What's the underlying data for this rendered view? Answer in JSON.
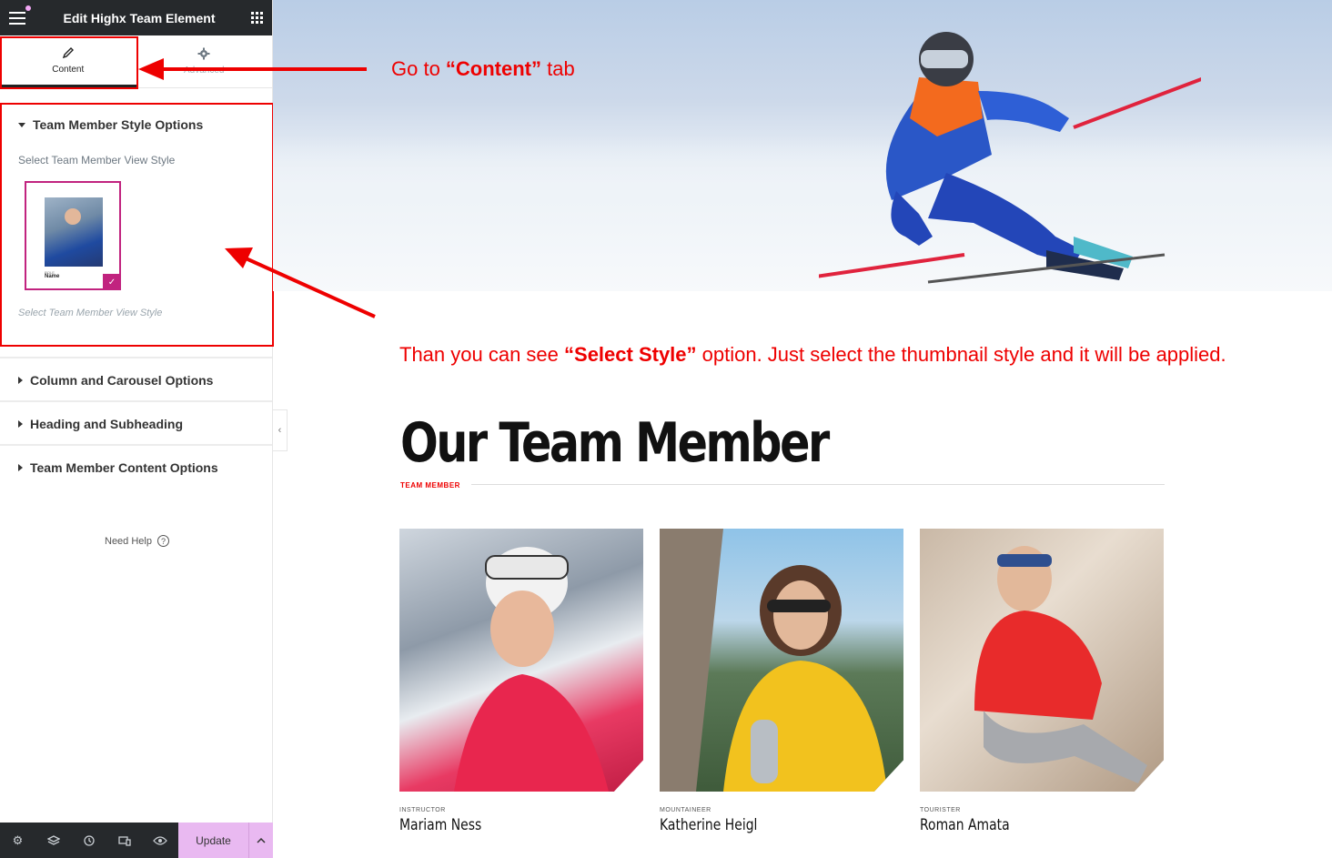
{
  "panel": {
    "title": "Edit Highx Team Element",
    "tabs": [
      {
        "label": "Content",
        "icon": "pencil-icon"
      },
      {
        "label": "Advanced",
        "icon": "gear-icon"
      }
    ],
    "sections": [
      {
        "label": "Team Member Style Options",
        "expanded": true
      },
      {
        "label": "Column and Carousel Options",
        "expanded": false
      },
      {
        "label": "Heading and Subheading",
        "expanded": false
      },
      {
        "label": "Team Member Content Options",
        "expanded": false
      }
    ],
    "style_field_label": "Select Team Member View Style",
    "style_field_note": "Select Team Member View Style",
    "need_help": "Need Help",
    "footer": {
      "update_label": "Update"
    }
  },
  "annotations": {
    "content_tab": {
      "pre": "Go  to ",
      "bold": "“Content”",
      "post": " tab"
    },
    "select_style": {
      "pre": "Than you can see ",
      "bold": "“Select Style”",
      "post": " option. Just select the thumbnail style and it will be applied."
    }
  },
  "preview": {
    "heading": "Our Team Member",
    "subheading": "TEAM MEMBER",
    "members": [
      {
        "role": "INSTRUCTOR",
        "name": "Mariam Ness"
      },
      {
        "role": "MOUNTAINEER",
        "name": "Katherine Heigl"
      },
      {
        "role": "TOURISTER",
        "name": "Roman Amata"
      }
    ]
  },
  "colors": {
    "accent": "#c1237f",
    "annotation": "#ee0000",
    "topbar": "#26292c",
    "update_button": "#e9b9f1"
  }
}
